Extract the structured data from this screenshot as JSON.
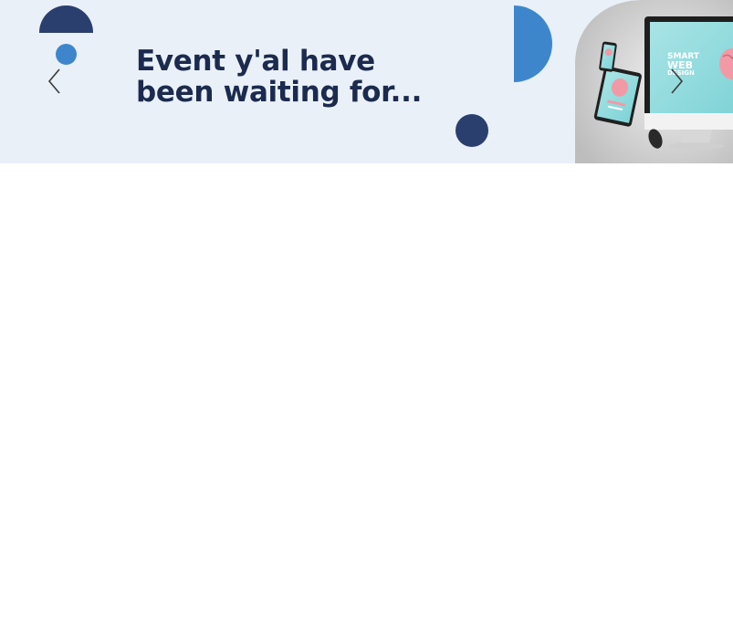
{
  "banner": {
    "headline_line1": "Event y'al have",
    "headline_line2": "been waiting for...",
    "background_color": "#e9f0f7",
    "headline_color": "#1b2a4e",
    "accent_dark": "#2b3f6e",
    "accent_blue": "#3e86cc",
    "image": {
      "icon": "devices-photo",
      "screen_text_line1": "SMART",
      "screen_text_line2": "WEB",
      "screen_text_line3": "DESIGN"
    }
  },
  "carousel": {
    "prev_icon": "chevron-left-icon",
    "next_icon": "chevron-right-icon"
  }
}
